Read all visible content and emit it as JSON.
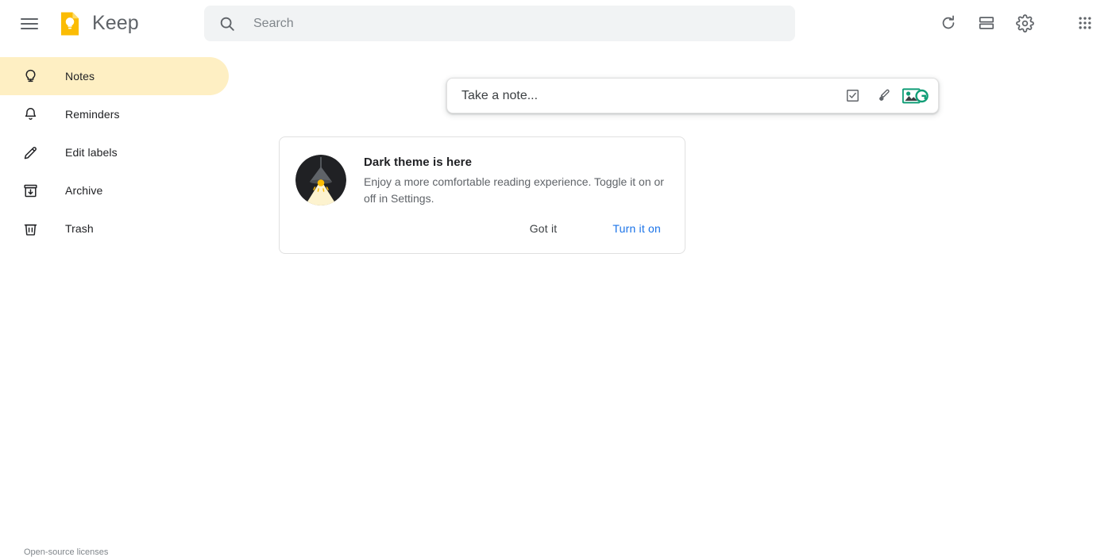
{
  "app": {
    "name": "Keep",
    "logo_icon": "keep-note-bulb-logo",
    "menu_icon": "hamburger-menu-icon"
  },
  "search": {
    "placeholder": "Search",
    "value": "",
    "icon": "search-icon"
  },
  "appbar_actions": [
    {
      "name": "refresh",
      "icon": "refresh-icon",
      "label": "Refresh"
    },
    {
      "name": "list-view",
      "icon": "list-view-icon",
      "label": "List view"
    },
    {
      "name": "settings",
      "icon": "gear-icon",
      "label": "Settings"
    },
    {
      "name": "google-apps",
      "icon": "apps-grid-icon",
      "label": "Google apps"
    }
  ],
  "sidebar": {
    "items": [
      {
        "label": "Notes",
        "icon": "lightbulb-icon",
        "active": true
      },
      {
        "label": "Reminders",
        "icon": "bell-icon",
        "active": false
      },
      {
        "label": "Edit labels",
        "icon": "pencil-icon",
        "active": false
      },
      {
        "label": "Archive",
        "icon": "archive-icon",
        "active": false
      },
      {
        "label": "Trash",
        "icon": "trash-icon",
        "active": false
      }
    ],
    "footer_link": "Open-source licenses"
  },
  "composer": {
    "placeholder": "Take a note...",
    "value": "",
    "tools": [
      {
        "name": "new-list",
        "icon": "checkbox-icon"
      },
      {
        "name": "new-drawing",
        "icon": "brush-icon"
      },
      {
        "name": "new-image",
        "icon": "image-with-g-badge-icon"
      }
    ]
  },
  "card": {
    "illustration": "dark-lamp-illustration",
    "title": "Dark theme is here",
    "description": "Enjoy a more comfortable reading experience. Toggle it on or off in Settings.",
    "dismiss_label": "Got it",
    "action_label": "Turn it on"
  },
  "colors": {
    "brand_yellow": "#fbbc04",
    "active_pill": "#feefc3",
    "link_blue": "#1a73e8",
    "icon_grey": "#5f6368",
    "search_bg": "#f1f3f4",
    "badge_teal": "#0f9d76"
  }
}
